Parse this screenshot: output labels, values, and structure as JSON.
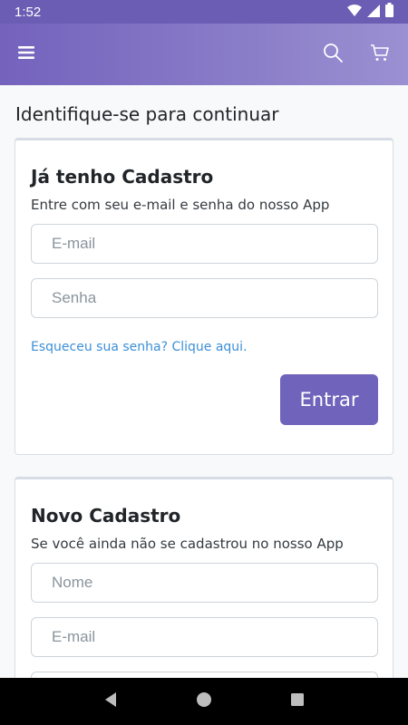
{
  "status_bar": {
    "time": "1:52"
  },
  "page": {
    "title": "Identifique-se para continuar"
  },
  "login_card": {
    "title": "Já tenho Cadastro",
    "subtitle": "Entre com seu e-mail e senha do nosso App",
    "email_placeholder": "E-mail",
    "password_placeholder": "Senha",
    "forgot_link": "Esqueceu sua senha? Clique aqui.",
    "submit_label": "Entrar"
  },
  "signup_card": {
    "title": "Novo Cadastro",
    "subtitle": "Se você ainda não se cadastrou no nosso App",
    "name_placeholder": "Nome",
    "email_placeholder": "E-mail"
  },
  "icons": {
    "menu": "hamburger-menu-icon",
    "search": "search-icon",
    "cart": "shopping-cart-icon",
    "wifi": "wifi-icon",
    "signal": "cell-signal-icon",
    "battery": "battery-icon",
    "back": "nav-back-icon",
    "home": "nav-home-icon",
    "recents": "nav-recents-icon"
  },
  "colors": {
    "app_bar_start": "#7462bd",
    "app_bar_end": "#9b90d2",
    "primary_button": "#6f63bb",
    "link": "#3d8fd6"
  }
}
